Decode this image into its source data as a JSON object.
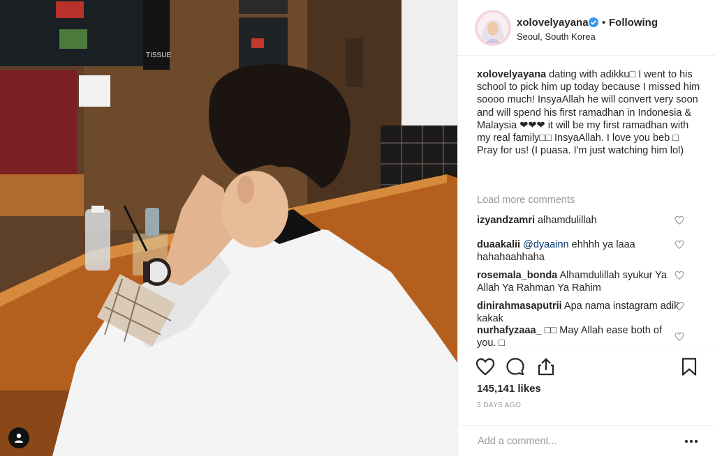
{
  "post": {
    "username": "xolovelyayana",
    "separator": "•",
    "follow_state": "Following",
    "location": "Seoul, South Korea"
  },
  "caption": {
    "username": "xolovelyayana",
    "text": " dating with adikku□ I went to his school to pick him up today because I missed him soooo much! InsyaAllah he will convert very soon and will spend his first ramadhan in Indonesia & Malaysia ❤❤❤ it will be my first ramadhan with my real family□□ InsyaAllah. I love you beb □ Pray for us! (I puasa. I'm just watching him lol)"
  },
  "load_more": "Load more comments",
  "comments": [
    {
      "user": "izyandzamri",
      "text": " alhamdulillah"
    },
    {
      "user": "duaakalii",
      "mention": "@dyaainn",
      "text": " ehhhh ya laaa hahahaahhaha"
    },
    {
      "user": "rosemala_bonda",
      "text": " Alhamdulillah syukur Ya Allah Ya Rahman Ya Rahim"
    },
    {
      "user": "dinirahmasaputrii",
      "text": " Apa nama instagram adik kakak"
    },
    {
      "user": "nurhafyzaaa_",
      "text": " □□ May Allah ease both of you. □"
    }
  ],
  "likes": "145,141 likes",
  "time_ago": "3 DAYS AGO",
  "add_comment_placeholder": "Add a comment...",
  "photo_sign": "TISSUE",
  "icons": {
    "like": "heart-outline-icon",
    "comment": "speech-bubble-icon",
    "share": "share-upload-icon",
    "save": "bookmark-icon",
    "more": "more-dots-icon",
    "verified": "verified-badge-icon",
    "user": "user-profile-icon"
  },
  "colors": {
    "verified": "#3897f0",
    "text": "#262626",
    "muted": "#999999",
    "border": "#efefef"
  }
}
